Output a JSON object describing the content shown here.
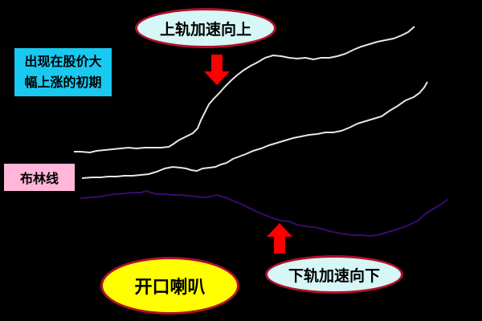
{
  "labels": {
    "upper_band_accelerates_up": "上轨加速向上",
    "lower_band_accelerates_down": "下轨加速向下",
    "early_rise_line1": "出现在股价大",
    "early_rise_line2": "幅上涨的初期",
    "bollinger_lines": "布林线",
    "bands_opening": "开口喇叭"
  },
  "colors": {
    "background": "#000000",
    "upper_band": "#e6e6e6",
    "middle_band": "#e6e6e6",
    "lower_band": "#3a0a6e",
    "arrow": "#ff0000",
    "bubble_fill": "#d6f7f5",
    "bubble_border": "#b0102a",
    "opening_fill": "#ffff00",
    "note_fill": "#19c9f0",
    "bollinger_fill": "#ffb6d9"
  },
  "icons": {
    "down_arrow": "red-down-arrow-icon",
    "up_arrow": "red-up-arrow-icon"
  }
}
